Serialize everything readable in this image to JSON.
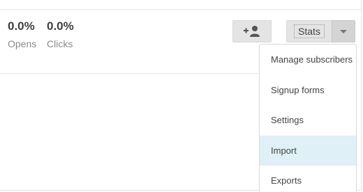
{
  "stats": {
    "opens": {
      "value": "0.0%",
      "label": "Opens"
    },
    "clicks": {
      "value": "0.0%",
      "label": "Clicks"
    }
  },
  "toolbar": {
    "add_subscriber_icon": "add-person-icon",
    "stats_label": "Stats",
    "dropdown_icon": "caret-down-icon"
  },
  "menu": {
    "items": [
      {
        "label": "Manage subscribers"
      },
      {
        "label": "Signup forms"
      },
      {
        "label": "Settings"
      },
      {
        "label": "Import",
        "highlighted": true
      },
      {
        "label": "Exports"
      }
    ]
  },
  "colors": {
    "highlight": "#dff0f6",
    "button_bg": "#e4e4e4",
    "toggle_bg": "#d4d4d4"
  }
}
